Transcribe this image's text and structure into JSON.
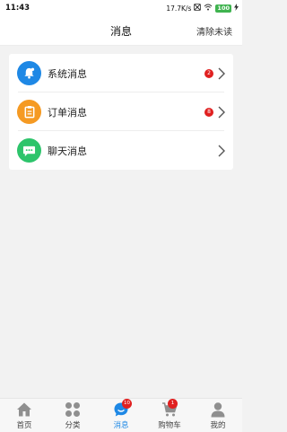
{
  "status_bar": {
    "time": "11:43",
    "network_speed": "17.7K/s",
    "battery": "100"
  },
  "header": {
    "title": "消息",
    "clear_unread": "清除未读"
  },
  "message_list": [
    {
      "label": "系统消息",
      "icon": "bell-icon",
      "color": "#1e88e5",
      "badge": "2"
    },
    {
      "label": "订单消息",
      "icon": "clipboard-icon",
      "color": "#f59a23",
      "badge": "8"
    },
    {
      "label": "聊天消息",
      "icon": "chat-bubble-icon",
      "color": "#2dc46b",
      "badge": ""
    }
  ],
  "tabbar": {
    "tabs": [
      {
        "label": "首页",
        "icon": "home-icon"
      },
      {
        "label": "分类",
        "icon": "grid-icon"
      },
      {
        "label": "消息",
        "icon": "message-icon",
        "badge": "10",
        "active": true
      },
      {
        "label": "购物车",
        "icon": "cart-icon",
        "badge": "1"
      },
      {
        "label": "我的",
        "icon": "profile-icon"
      }
    ]
  },
  "colors": {
    "accent": "#1e88e5",
    "badge": "#e02020",
    "orders": "#f59a23",
    "chat": "#2dc46b"
  }
}
